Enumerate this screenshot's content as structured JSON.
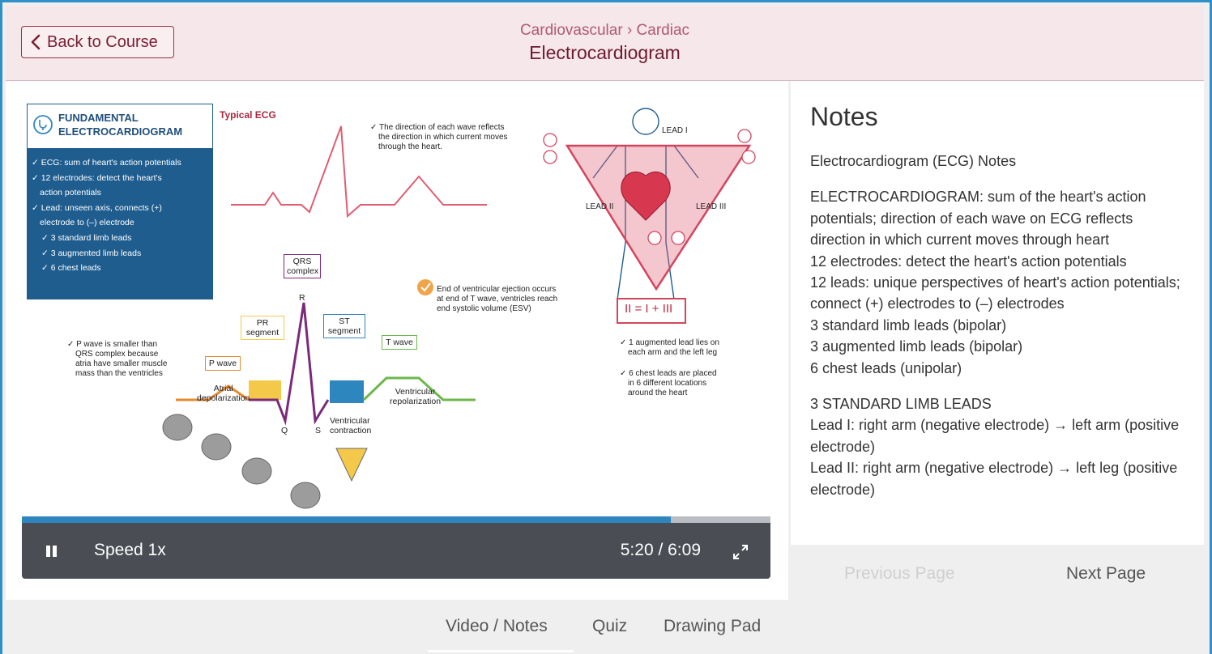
{
  "header": {
    "back_label": "Back to Course",
    "breadcrumb": "Cardiovascular › Cardiac",
    "title": "Electrocardiogram"
  },
  "slide": {
    "box_title_1": "FUNDAMENTAL",
    "box_title_2": "ELECTROCARDIOGRAM",
    "box_items": [
      "✓ ECG: sum of heart's action potentials",
      "✓ 12 electrodes: detect the heart's",
      "action potentials",
      "✓ Lead: unseen axis, connects (+)",
      "electrode to (–) electrode",
      "✓ 3 standard limb leads",
      "✓ 3 augmented limb leads",
      "✓ 6 chest leads"
    ],
    "typical_ecg": "Typical ECG",
    "direction_note": [
      "✓ The direction of each wave reflects",
      "the direction in which current moves",
      "through the heart."
    ],
    "lead_i": "LEAD I",
    "lead_ii": "LEAD II",
    "lead_iii": "LEAD III",
    "equation": "II = I + III",
    "augmented_note": [
      "✓ 1 augmented lead lies on",
      "each arm and the left leg"
    ],
    "chest_note": [
      "✓ 6 chest leads are placed",
      "in 6 different locations",
      "around the heart"
    ],
    "ejection_note": [
      "End of ventricular ejection occurs",
      "at end of T wave, ventricles reach",
      "end systolic volume (ESV)"
    ],
    "p_wave_note": [
      "✓ P wave is smaller than",
      "QRS complex because",
      "atria have smaller muscle",
      "mass than the ventricles"
    ],
    "qrs": [
      "QRS",
      "complex"
    ],
    "r": "R",
    "q": "Q",
    "s": "S",
    "pr": [
      "PR",
      "segment"
    ],
    "st": [
      "ST",
      "segment"
    ],
    "t_wave": "T wave",
    "p_wave": "P wave",
    "atrial": [
      "Atrial",
      "depolarization"
    ],
    "ventricular_contraction": [
      "Ventricular",
      "contraction"
    ],
    "ventricular_repol": [
      "Ventricular",
      "repolarization"
    ]
  },
  "player": {
    "speed_label": "Speed 1x",
    "time": "5:20 / 6:09",
    "progress": 0.867
  },
  "notes": {
    "heading": "Notes",
    "subtitle": "Electrocardiogram (ECG) Notes",
    "block1": "ELECTROCARDIOGRAM: sum of the heart's action potentials; direction of each wave on ECG reflects direction in which current moves through heart",
    "line2": "12 electrodes: detect the heart's action potentials",
    "line3": "12 leads: unique perspectives of heart's action potentials; connect (+) electrodes to (–) electrodes",
    "line4": "3 standard limb leads (bipolar)",
    "line5": "3 augmented limb leads (bipolar)",
    "line6": "6 chest leads (unipolar)",
    "section2": "3 STANDARD LIMB LEADS",
    "lead1": "Lead I: right arm (negative electrode) → left arm (positive electrode)",
    "lead2": "Lead II: right arm (negative electrode) → left leg (positive electrode)"
  },
  "pager": {
    "prev": "Previous Page",
    "next": "Next Page"
  },
  "tabs": {
    "video_notes": "Video / Notes",
    "quiz": "Quiz",
    "drawing_pad": "Drawing Pad"
  },
  "colors": {
    "border": "#2f8fc6",
    "header_bg": "#f6e7ea",
    "accent": "#7b1e34",
    "progress": "#2e86bf"
  }
}
